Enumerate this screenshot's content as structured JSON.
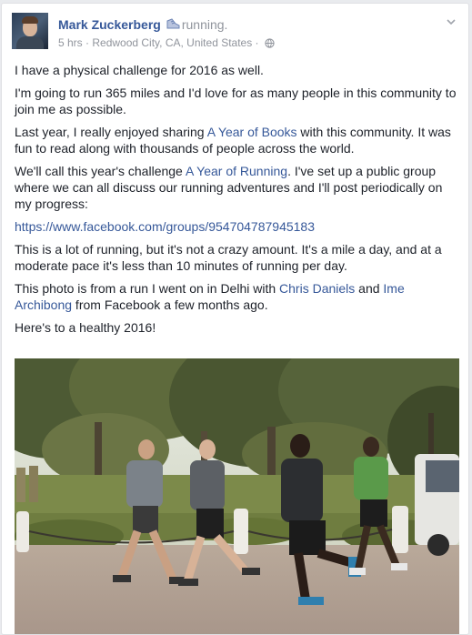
{
  "post": {
    "author": "Mark Zuckerberg",
    "activity": "running.",
    "time": "5 hrs",
    "location": "Redwood City, CA, United States",
    "separator": " · ",
    "paragraphs": [
      [
        {
          "t": "I have a physical challenge for 2016 as well."
        }
      ],
      [
        {
          "t": "I'm going to run 365 miles and I'd love for as many people in this community to join me as possible."
        }
      ],
      [
        {
          "t": "Last year, I really enjoyed sharing "
        },
        {
          "t": "A Year of Books",
          "link": true
        },
        {
          "t": " with this community. It was fun to read along with thousands of people across the world."
        }
      ],
      [
        {
          "t": "We'll call this year's challenge "
        },
        {
          "t": "A Year of Running",
          "link": true
        },
        {
          "t": ". I've set up a public group where we can all discuss our running adventures and I'll post periodically on my progress:"
        }
      ],
      [
        {
          "t": "https://www.facebook.com/groups/954704787945183",
          "link": true
        }
      ],
      [
        {
          "t": "This is a lot of running, but it's not a crazy amount. It's a mile a day, and at a moderate pace it's less than 10 minutes of running per day."
        }
      ],
      [
        {
          "t": "This photo is from a run I went on in Delhi with "
        },
        {
          "t": "Chris Daniels",
          "link": true
        },
        {
          "t": " and "
        },
        {
          "t": "Ime Archibong",
          "link": true
        },
        {
          "t": " from Facebook a few months ago."
        }
      ],
      [
        {
          "t": "Here's to a healthy 2016!"
        }
      ]
    ]
  },
  "icons": {
    "activity": "running-shoe-icon",
    "privacy": "globe-icon",
    "menu": "chevron-down-icon"
  },
  "colors": {
    "link": "#365899",
    "text": "#1d2129",
    "meta": "#90949c"
  }
}
